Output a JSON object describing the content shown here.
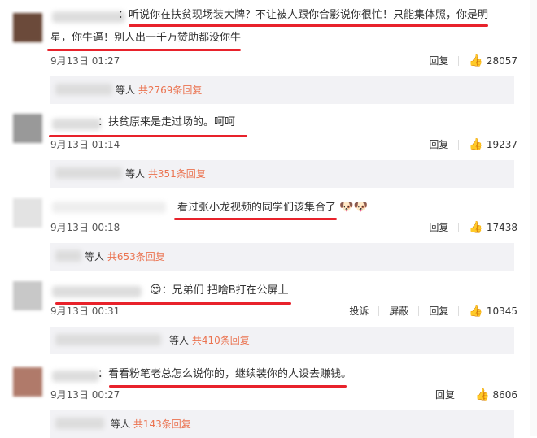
{
  "comments": [
    {
      "text_line1": "：听说你在扶贫现场装大牌？不让被人跟你合影说你很忙！只能集体照，你是明",
      "text_line2": "星，你牛逼！别人出一千万赞助都没你牛",
      "time": "9月13日 01:27",
      "reply": "回复",
      "likes": "28057",
      "sub_suffix": "等人",
      "sub_link": "共2769条回复"
    },
    {
      "text_line1": "：扶贫原来是走过场的。呵呵",
      "time": "9月13日 01:14",
      "reply": "回复",
      "likes": "19237",
      "sub_suffix": "等人",
      "sub_link": "共351条回复"
    },
    {
      "text_line1": "看过张小龙视频的同学们该集合了",
      "time": "9月13日 00:18",
      "reply": "回复",
      "likes": "17438",
      "sub_suffix": "等人",
      "sub_link": "共653条回复"
    },
    {
      "text_line1": "：兄弟们 把啥B打在公屏上",
      "time": "9月13日 00:31",
      "report": "投诉",
      "block": "屏蔽",
      "reply": "回复",
      "likes": "10345",
      "sub_suffix": "等人",
      "sub_link": "共410条回复"
    },
    {
      "text_line1": "：看看粉笔老总怎么说你的，继续装你的人设去赚钱。",
      "time": "9月13日 00:27",
      "reply": "回复",
      "likes": "8606",
      "sub_suffix": "等人",
      "sub_link": "共143条回复"
    }
  ],
  "icons": {
    "like": "thumbs-up-icon",
    "emoji": "doge-emoji-icon"
  },
  "colors": {
    "underline": "#e8222b",
    "link": "#eb7350"
  }
}
